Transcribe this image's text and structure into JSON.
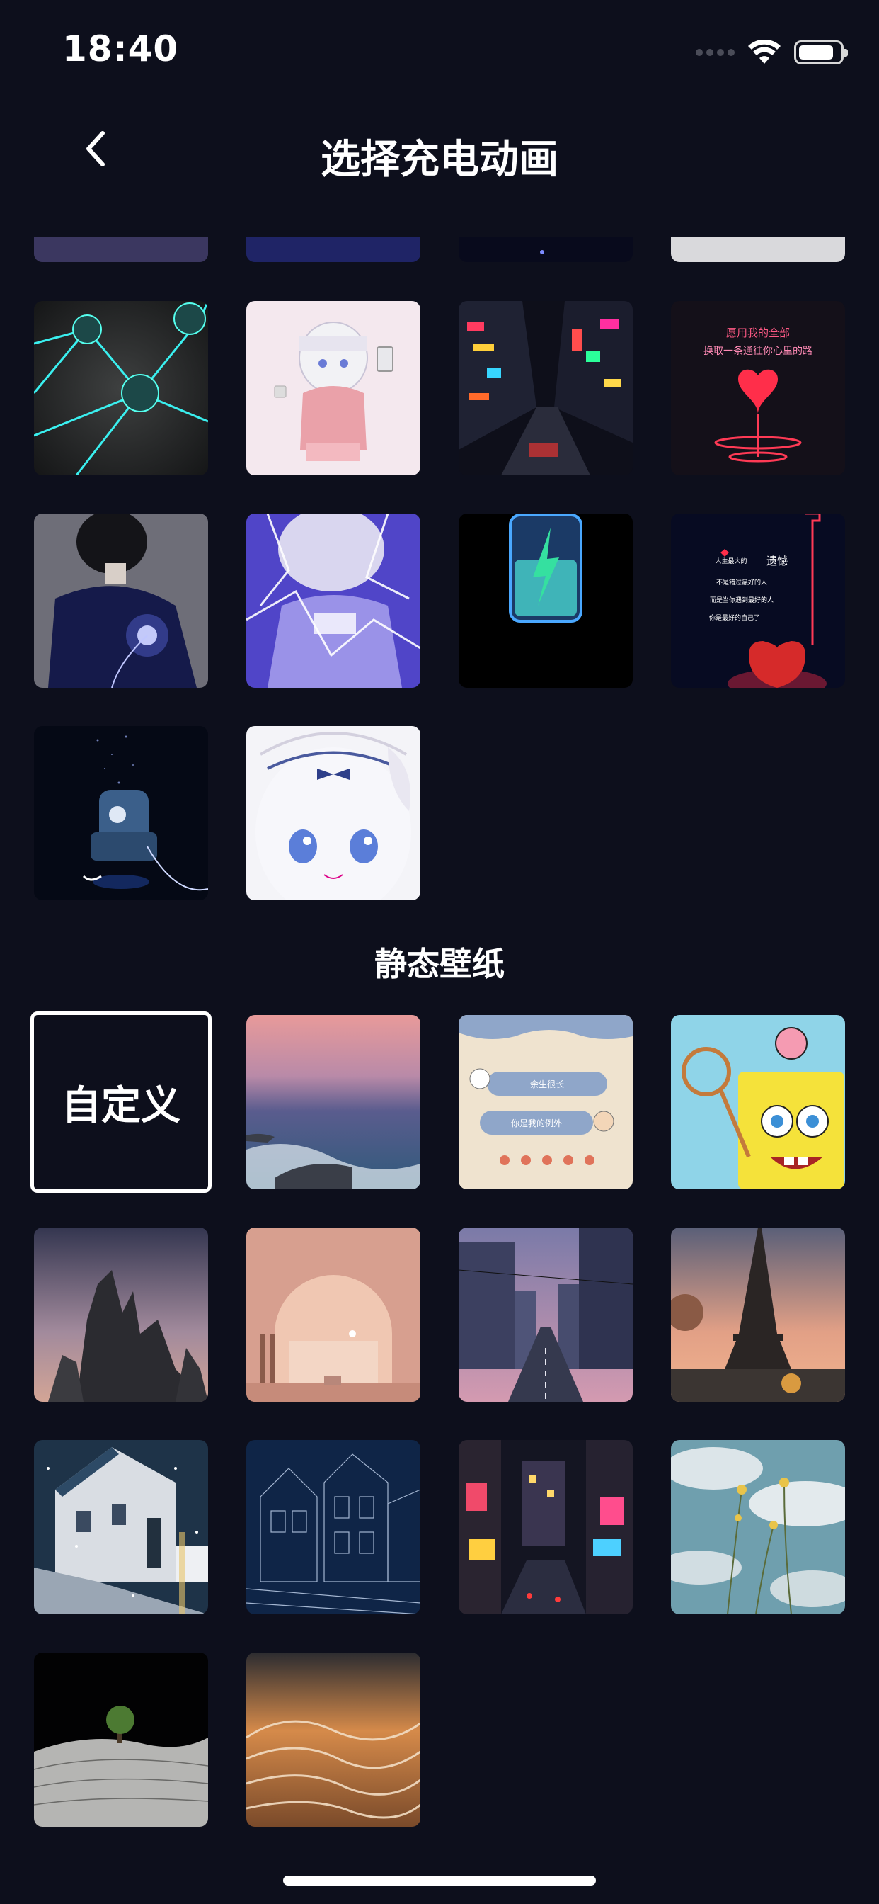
{
  "status_bar": {
    "time": "18:40"
  },
  "header": {
    "title": "选择充电动画",
    "back_icon": "chevron-left-icon"
  },
  "animations": {
    "items": [
      {
        "name": "partial-purple"
      },
      {
        "name": "partial-dark-blue"
      },
      {
        "name": "partial-night"
      },
      {
        "name": "partial-light"
      },
      {
        "name": "neon-network"
      },
      {
        "name": "anime-girl-pink"
      },
      {
        "name": "neon-city-street"
      },
      {
        "name": "neon-heart-text",
        "text": [
          "愿用我的全部",
          "换取一条通往你心里的路"
        ]
      },
      {
        "name": "anime-boy-glow"
      },
      {
        "name": "anime-girl-lightning"
      },
      {
        "name": "battery-bolt"
      },
      {
        "name": "neon-apple-text",
        "text": [
          "人生最大的",
          "遗憾",
          "不是错过最好的人",
          "而是当你遇到最好的人",
          "你是最好的自己了"
        ]
      },
      {
        "name": "astronaut-chair"
      },
      {
        "name": "anime-girl-closeup"
      }
    ]
  },
  "static_wallpapers": {
    "section_title": "静态壁纸",
    "custom_label": "自定义",
    "items": [
      {
        "name": "ocean-sunset"
      },
      {
        "name": "cute-chat",
        "text": [
          "余生很长",
          "你是我的例外"
        ]
      },
      {
        "name": "spongebob"
      },
      {
        "name": "rock-spires"
      },
      {
        "name": "pink-arch-moon"
      },
      {
        "name": "japan-street"
      },
      {
        "name": "eiffel-tower"
      },
      {
        "name": "snowy-houses"
      },
      {
        "name": "line-art-buildings"
      },
      {
        "name": "times-square"
      },
      {
        "name": "flowers-sky"
      },
      {
        "name": "tree-night-dunes"
      },
      {
        "name": "orange-rock-waves"
      }
    ]
  }
}
